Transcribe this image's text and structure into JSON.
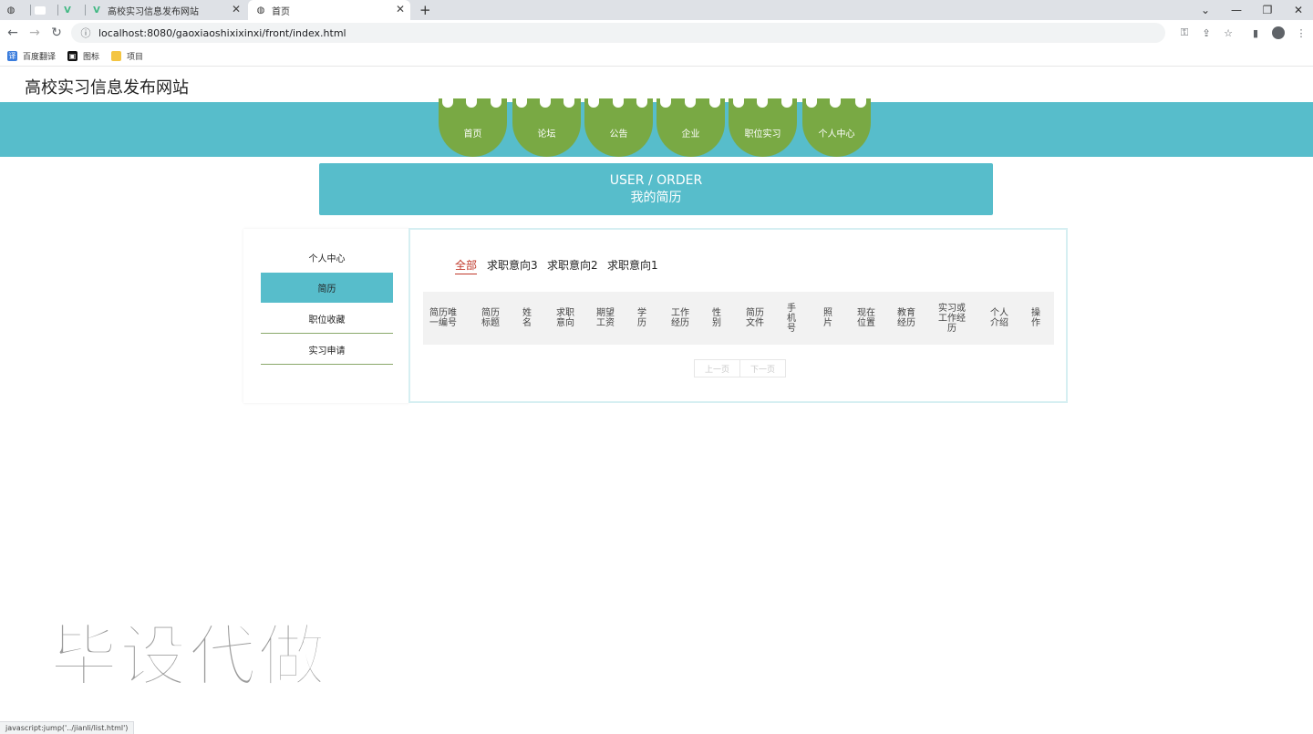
{
  "browser": {
    "tabs": [
      {
        "label": ""
      },
      {
        "label": ""
      },
      {
        "label": ""
      },
      {
        "label": "高校实习信息发布网站"
      },
      {
        "label": "首页"
      }
    ],
    "new_tab": "+",
    "url": "localhost:8080/gaoxiaoshixixinxi/front/index.html",
    "bookmarks": [
      {
        "label": "百度翻译"
      },
      {
        "label": "图标"
      },
      {
        "label": "项目"
      }
    ],
    "status_text": "javascript:jump('../jianli/list.html')"
  },
  "site": {
    "title": "高校实习信息发布网站",
    "nav": [
      "首页",
      "论坛",
      "公告",
      "企业",
      "职位实习",
      "个人中心"
    ],
    "banner": {
      "line1": "USER / ORDER",
      "line2": "我的简历"
    }
  },
  "sidebar": {
    "items": [
      {
        "label": "个人中心",
        "active": false
      },
      {
        "label": "简历",
        "active": true
      },
      {
        "label": "职位收藏",
        "active": false
      },
      {
        "label": "实习申请",
        "active": false
      }
    ]
  },
  "filters": [
    "全部",
    "求职意向3",
    "求职意向2",
    "求职意向1"
  ],
  "table": {
    "headers": [
      "简历唯一编号",
      "简历标题",
      "姓名",
      "求职意向",
      "期望工资",
      "学历",
      "工作经历",
      "性别",
      "简历文件",
      "手机号",
      "照片",
      "现在位置",
      "教育经历",
      "实习或工作经历",
      "个人介绍",
      "操作"
    ]
  },
  "pager": {
    "prev": "上一页",
    "next": "下一页"
  },
  "watermark": "毕设代做",
  "colors": {
    "teal": "#57bdcb",
    "green": "#79a944",
    "active_filter": "#c0392b"
  }
}
